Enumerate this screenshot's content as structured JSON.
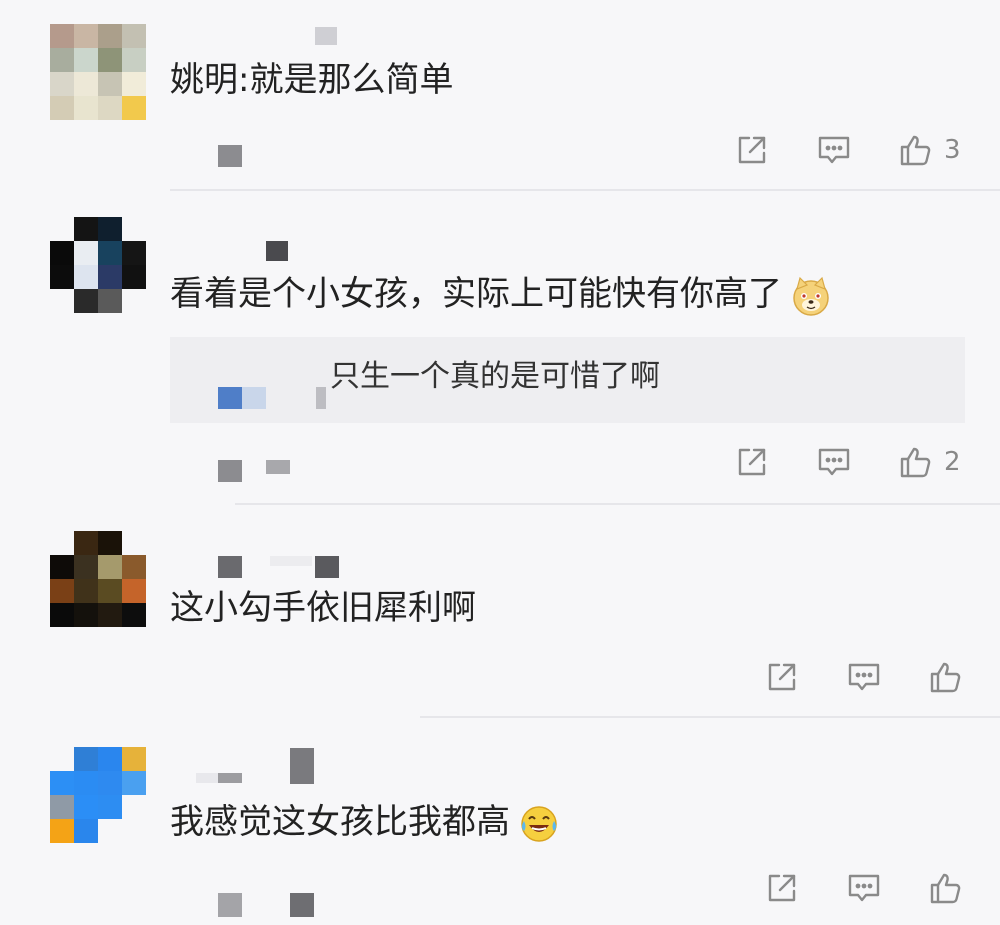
{
  "comments": [
    {
      "text": "姚明:就是那么简单",
      "like_count": "3",
      "avatar_colors": [
        "#b59a8c",
        "#c9b6a4",
        "#ab9f8b",
        "#c3c0b2",
        "#a8ad9e",
        "#cbd6cc",
        "#8e9478",
        "#c8cfc3",
        "#d9d6c9",
        "#ede8d7",
        "#c7c4b4",
        "#f1ecd9",
        "#d4ccb5",
        "#e8e4cf",
        "#ddd8c3",
        "#f2c94c"
      ]
    },
    {
      "text": "看着是个小女孩，实际上可能快有你高了",
      "like_count": "2",
      "reply_text": "只生一个真的是可惜了啊",
      "avatar_colors": [
        "#f7f7f9",
        "#141414",
        "#0f1f2e",
        "#f7f7f9",
        "#0a0a0a",
        "#e9edf2",
        "#18425e",
        "#151515",
        "#0c0c0c",
        "#dde4ef",
        "#2b3a66",
        "#111111",
        "#f7f7f9",
        "#2a2a2a",
        "#5a5a5a",
        "#f7f7f9"
      ]
    },
    {
      "text": "这小勾手依旧犀利啊",
      "like_count": "",
      "avatar_colors": [
        "#f7f7f9",
        "#3a2712",
        "#1a1208",
        "#f7f7f9",
        "#0e0b08",
        "#3b3120",
        "#a59a6c",
        "#8a5a2c",
        "#7a4016",
        "#40321a",
        "#5a4b22",
        "#c5642a",
        "#0a0a0a",
        "#14110c",
        "#221a10",
        "#0d0d0d"
      ]
    },
    {
      "text": "我感觉这女孩比我都高",
      "like_count": "",
      "avatar_colors": [
        "#f7f7f9",
        "#2f7fd6",
        "#2a86ee",
        "#e6b23a",
        "#2c8ff5",
        "#2b8cf3",
        "#2e8af0",
        "#4aa0f0",
        "#8f9aa6",
        "#2b8ef6",
        "#2d8df2",
        "#f7f7f9",
        "#f4a316",
        "#2a86ec",
        "#f7f7f9",
        "#f7f7f9"
      ]
    }
  ],
  "icons": {
    "share": "share-icon",
    "comment": "comment-icon",
    "like": "thumbs-up-icon",
    "emoji_doge": "doge-emoji-icon",
    "emoji_laugh_cry": "laugh-cry-emoji-icon"
  },
  "colors": {
    "background": "#f7f7f9",
    "reply_background": "#eeeef1",
    "text": "#222222",
    "icon": "#8a8a8a",
    "divider": "#e6e6ea"
  }
}
